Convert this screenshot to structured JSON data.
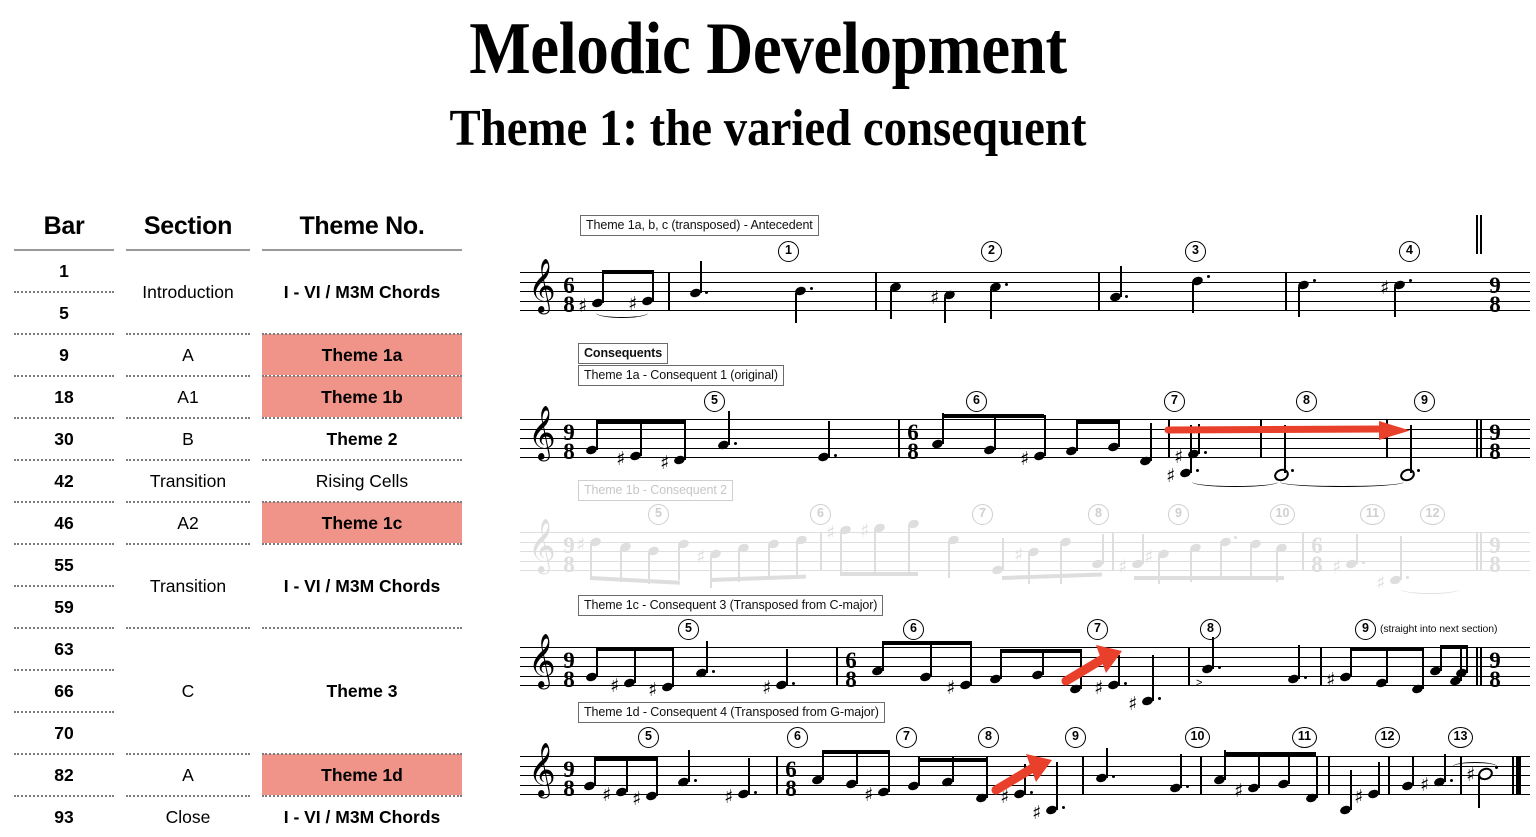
{
  "title": {
    "main": "Melodic Development",
    "sub": "Theme 1: the varied consequent"
  },
  "colors": {
    "highlight": "#f0948a",
    "arrow_red": "#e8402a",
    "faded": "#dedede",
    "rule": "#9a9a9a"
  },
  "table": {
    "headers": [
      "Bar",
      "Section",
      "Theme No."
    ],
    "rows": [
      {
        "bars": [
          "1",
          "5"
        ],
        "section": "Introduction",
        "theme": "I - VI / M3M Chords",
        "theme_bold": true,
        "highlight": false
      },
      {
        "bars": [
          "9"
        ],
        "section": "A",
        "theme": "Theme 1a",
        "theme_bold": true,
        "highlight": true
      },
      {
        "bars": [
          "18"
        ],
        "section": "A1",
        "theme": "Theme 1b",
        "theme_bold": true,
        "highlight": true
      },
      {
        "bars": [
          "30"
        ],
        "section": "B",
        "theme": "Theme 2",
        "theme_bold": true,
        "highlight": false
      },
      {
        "bars": [
          "42"
        ],
        "section": "Transition",
        "theme": "Rising Cells",
        "theme_bold": false,
        "highlight": false
      },
      {
        "bars": [
          "46"
        ],
        "section": "A2",
        "theme": "Theme 1c",
        "theme_bold": true,
        "highlight": true
      },
      {
        "bars": [
          "55",
          "59"
        ],
        "section": "Transition",
        "theme": "I - VI / M3M Chords",
        "theme_bold": true,
        "highlight": false
      },
      {
        "bars": [
          "63",
          "66",
          "70"
        ],
        "section": "C",
        "theme": "Theme 3",
        "theme_bold": true,
        "highlight": false
      },
      {
        "bars": [
          "82"
        ],
        "section": "A",
        "theme": "Theme 1d",
        "theme_bold": true,
        "highlight": true
      },
      {
        "bars": [
          "93"
        ],
        "section": "Close",
        "theme": "I - VI / M3M Chords",
        "theme_bold": true,
        "highlight": false
      }
    ]
  },
  "score": {
    "group_label": "Consequents",
    "systems": [
      {
        "id": "system-antecedent",
        "label": "Theme 1a, b, c (transposed) - Antecedent",
        "faded": false,
        "time_sig": {
          "top": "6",
          "bottom": "8"
        },
        "end_time_sig": {
          "top": "9",
          "bottom": "8"
        },
        "bar_numbers": [
          "1",
          "2",
          "3",
          "4"
        ]
      },
      {
        "id": "system-consequent-1",
        "label": "Theme 1a - Consequent 1 (original)",
        "faded": false,
        "time_sig": {
          "top": "9",
          "bottom": "8"
        },
        "mid_time_sig": {
          "top": "6",
          "bottom": "8"
        },
        "end_time_sig": {
          "top": "9",
          "bottom": "8"
        },
        "bar_numbers": [
          "5",
          "6",
          "7",
          "8",
          "9"
        ],
        "arrow": "long-horizontal-red-arrow"
      },
      {
        "id": "system-consequent-2",
        "label": "Theme 1b - Consequent 2",
        "faded": true,
        "time_sig": {
          "top": "9",
          "bottom": "8"
        },
        "mid_time_sig": {
          "top": "6",
          "bottom": "8"
        },
        "end_time_sig": {
          "top": "9",
          "bottom": "8"
        },
        "bar_numbers": [
          "5",
          "6",
          "7",
          "8",
          "9",
          "10",
          "11",
          "12"
        ]
      },
      {
        "id": "system-consequent-3",
        "label": "Theme 1c - Consequent 3 (Transposed from C-major)",
        "faded": false,
        "time_sig": {
          "top": "9",
          "bottom": "8"
        },
        "mid_time_sig": {
          "top": "6",
          "bottom": "8"
        },
        "end_time_sig": {
          "top": "9",
          "bottom": "8"
        },
        "bar_numbers": [
          "5",
          "6",
          "7",
          "8",
          "9"
        ],
        "annotation": "(straight into next section)",
        "arrow": "diagonal-red-arrow"
      },
      {
        "id": "system-consequent-4",
        "label": "Theme 1d - Consequent 4 (Transposed from G-major)",
        "faded": false,
        "time_sig": {
          "top": "9",
          "bottom": "8"
        },
        "mid_time_sig": {
          "top": "6",
          "bottom": "8"
        },
        "bar_numbers": [
          "5",
          "6",
          "7",
          "8",
          "9",
          "10",
          "11",
          "12",
          "13"
        ],
        "arrow": "diagonal-red-arrow"
      }
    ]
  }
}
